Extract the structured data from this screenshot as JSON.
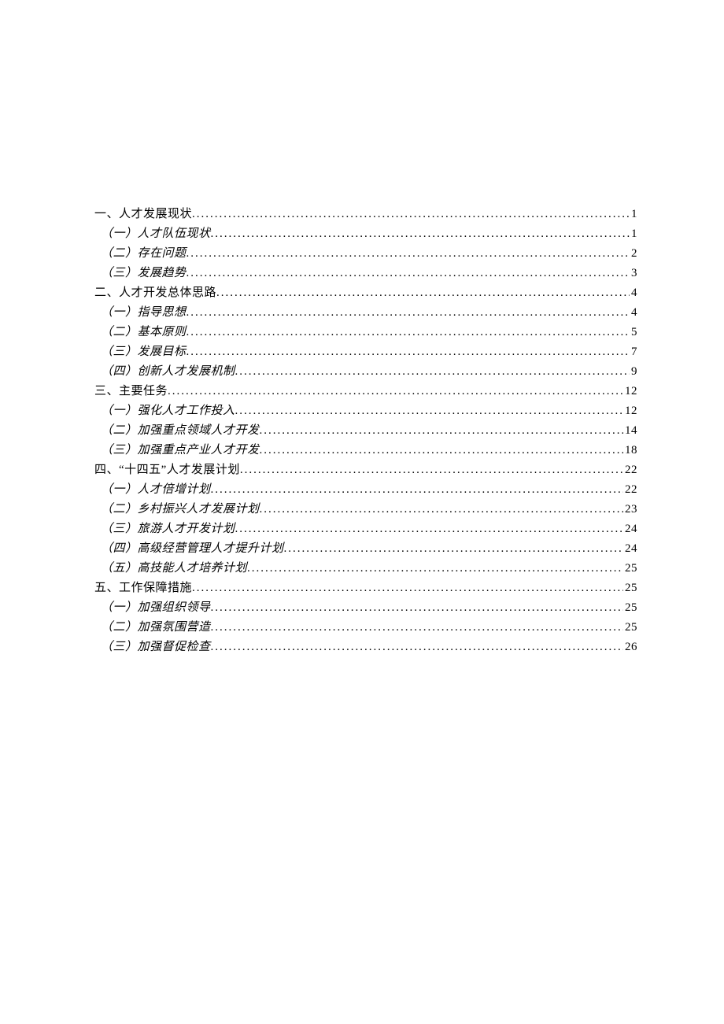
{
  "toc": [
    {
      "level": 1,
      "title": "一、人才发展现状",
      "page": "1"
    },
    {
      "level": 2,
      "title": "（一）人才队伍现状",
      "page": "1"
    },
    {
      "level": 2,
      "title": "（二）存在问题",
      "page": "2"
    },
    {
      "level": 2,
      "title": "（三）发展趋势",
      "page": "3"
    },
    {
      "level": 1,
      "title": "二、人才开发总体思路",
      "page": "4"
    },
    {
      "level": 2,
      "title": "（一）指导思想",
      "page": "4"
    },
    {
      "level": 2,
      "title": "（二）基本原则",
      "page": "5"
    },
    {
      "level": 2,
      "title": "（三）发展目标",
      "page": "7"
    },
    {
      "level": 2,
      "title": "（四）创新人才发展机制",
      "page": "9"
    },
    {
      "level": 1,
      "title": "三、主要任务",
      "page": "12"
    },
    {
      "level": 2,
      "title": "（一）强化人才工作投入",
      "page": "12"
    },
    {
      "level": 2,
      "title": "（二）加强重点领域人才开发",
      "page": "14"
    },
    {
      "level": 2,
      "title": "（三）加强重点产业人才开发",
      "page": "18"
    },
    {
      "level": 1,
      "title": "四、“十四五”人才发展计划",
      "page": "22"
    },
    {
      "level": 2,
      "title": "（一）人才倍增计划",
      "page": "22"
    },
    {
      "level": 2,
      "title": "（二）乡村振兴人才发展计划",
      "page": "23"
    },
    {
      "level": 2,
      "title": "（三）旅游人才开发计划",
      "page": "24"
    },
    {
      "level": 2,
      "title": "（四）高级经营管理人才提升计划",
      "page": "24"
    },
    {
      "level": 2,
      "title": "（五）高技能人才培养计划",
      "page": "25"
    },
    {
      "level": 1,
      "title": "五、工作保障措施",
      "page": "25"
    },
    {
      "level": 2,
      "title": "（一）加强组织领导",
      "page": "25"
    },
    {
      "level": 2,
      "title": "（二）加强氛围营造",
      "page": "25"
    },
    {
      "level": 2,
      "title": "（三）加强督促检查",
      "page": "26"
    }
  ]
}
